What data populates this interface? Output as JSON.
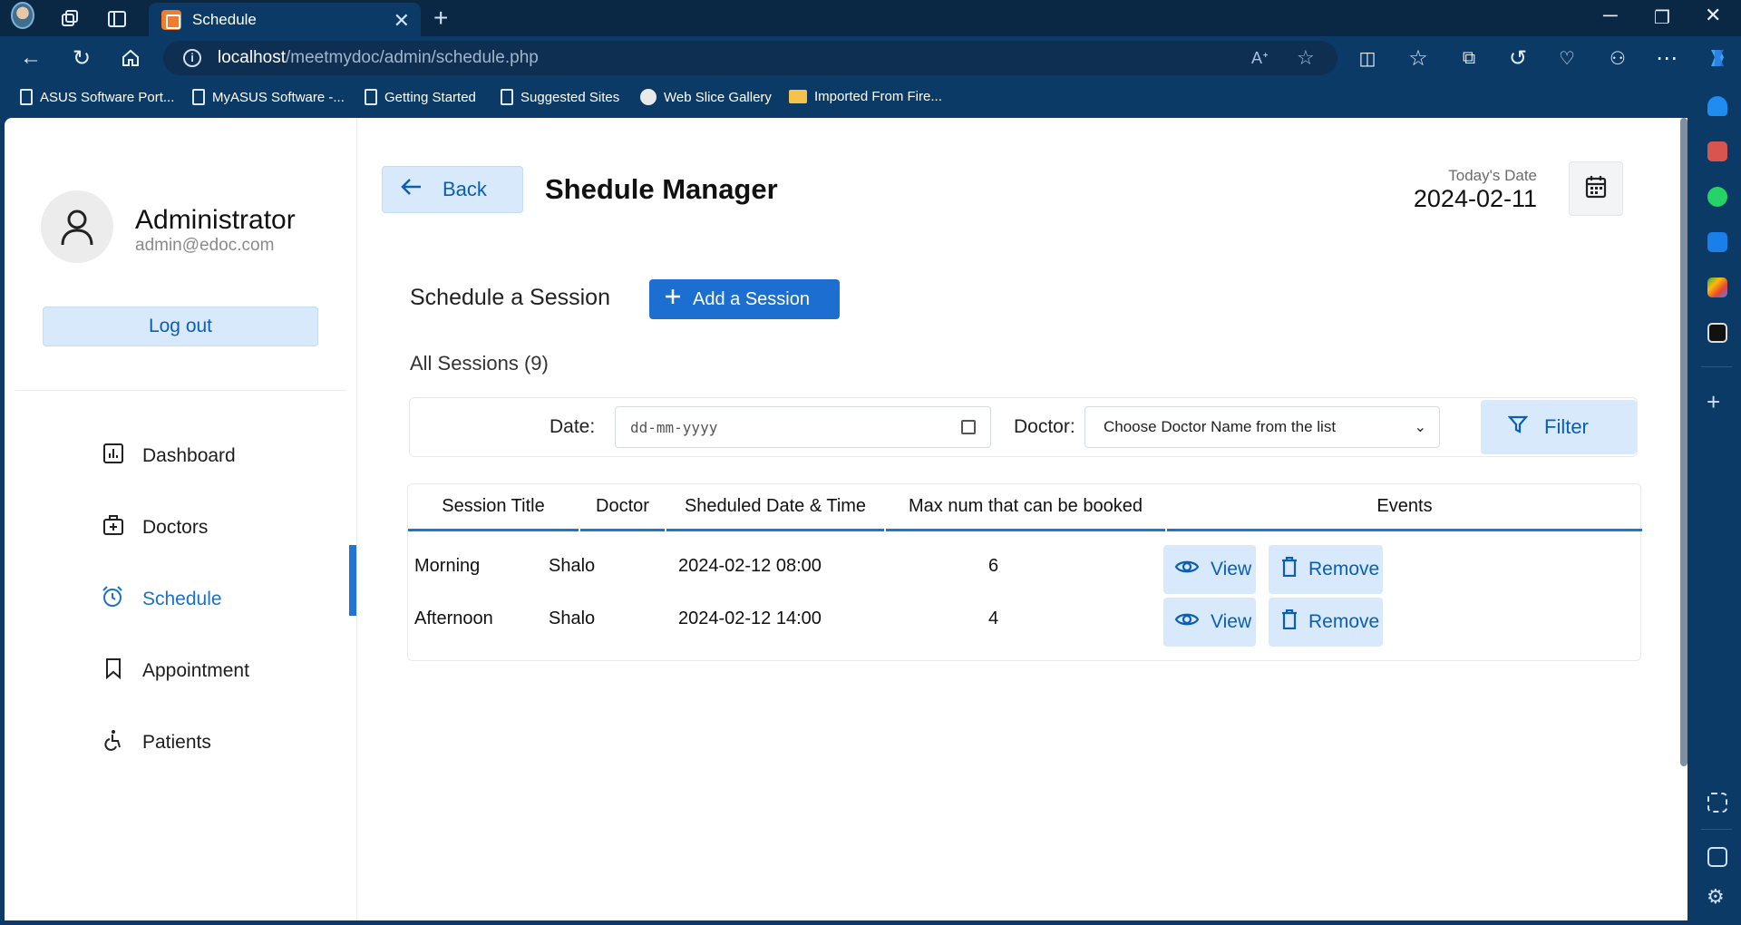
{
  "browser": {
    "tab_title": "Schedule",
    "url_host": "localhost",
    "url_path": "/meetmydoc/admin/schedule.php",
    "bookmarks": [
      {
        "label": "ASUS Software Port...",
        "icon": "page-icon"
      },
      {
        "label": "MyASUS Software -...",
        "icon": "page-icon"
      },
      {
        "label": "Getting Started",
        "icon": "page-icon"
      },
      {
        "label": "Suggested Sites",
        "icon": "page-icon"
      },
      {
        "label": "Web Slice Gallery",
        "icon": "gallery-icon"
      },
      {
        "label": "Imported From Fire...",
        "icon": "folder-icon"
      }
    ]
  },
  "profile": {
    "name": "Administrator",
    "email": "admin@edoc.com",
    "logout_label": "Log out"
  },
  "menu": [
    {
      "label": "Dashboard",
      "icon": "dashboard-icon",
      "active": false
    },
    {
      "label": "Doctors",
      "icon": "doctor-icon",
      "active": false
    },
    {
      "label": "Schedule",
      "icon": "alarm-clock-icon",
      "active": true
    },
    {
      "label": "Appointment",
      "icon": "bookmark-icon",
      "active": false
    },
    {
      "label": "Patients",
      "icon": "wheelchair-icon",
      "active": false
    }
  ],
  "header": {
    "back_label": "Back",
    "title": "Shedule Manager",
    "today_label": "Today's Date",
    "today_value": "2024-02-11"
  },
  "schedule": {
    "title": "Schedule a Session",
    "add_label": "Add a Session",
    "all_sessions_label": "All Sessions (9)"
  },
  "filter": {
    "date_label": "Date:",
    "date_placeholder": "dd-mm-yyyy",
    "doctor_label": "Doctor:",
    "doctor_selected": "Choose Doctor Name from the list",
    "filter_label": "Filter"
  },
  "table": {
    "headers": [
      "Session Title",
      "Doctor",
      "Sheduled Date & Time",
      "Max num that can be booked",
      "Events"
    ],
    "rows": [
      {
        "title": "Morning",
        "doctor": "Shalo",
        "datetime": "2024-02-12 08:00",
        "max": "6"
      },
      {
        "title": "Afternoon",
        "doctor": "Shalo",
        "datetime": "2024-02-12 14:00",
        "max": "4"
      }
    ],
    "view_label": "View",
    "remove_label": "Remove"
  },
  "colors": {
    "accent": "#1c6fd0",
    "light_button": "#d8e9fb",
    "browser_chrome": "#0b3a66"
  }
}
